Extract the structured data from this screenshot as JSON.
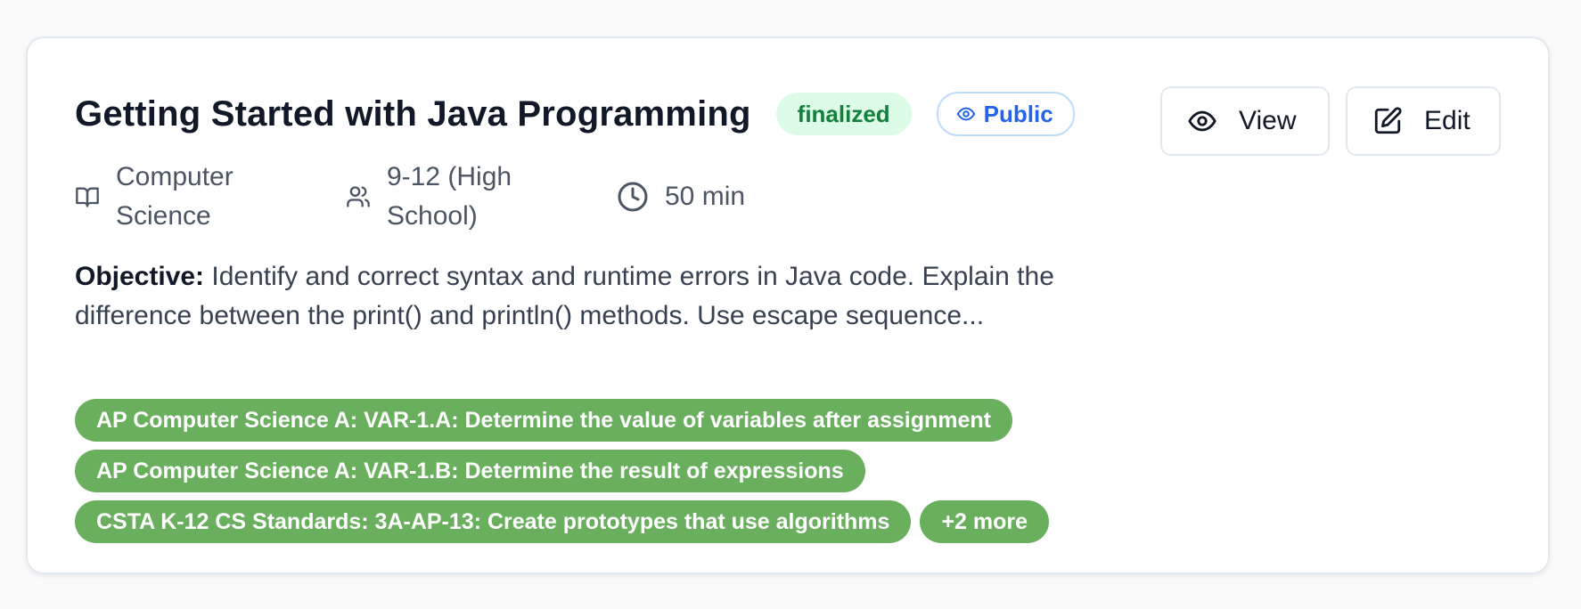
{
  "card": {
    "title": "Getting Started with Java Programming",
    "status_badge": "finalized",
    "visibility_badge": "Public",
    "actions": {
      "view_label": "View",
      "edit_label": "Edit"
    },
    "meta": {
      "subject": "Computer Science",
      "grade": "9-12 (High School)",
      "duration": "50 min"
    },
    "objective": {
      "label": "Objective:",
      "text": "Identify and correct syntax and runtime errors in Java code. Explain the difference between the print() and println() methods. Use escape sequence..."
    },
    "standards": [
      "AP Computer Science A: VAR-1.A: Determine the value of variables after assignment",
      "AP Computer Science A: VAR-1.B: Determine the result of expressions",
      "CSTA K-12 CS Standards: 3A-AP-13: Create prototypes that use algorithms"
    ],
    "more_standards": "+2 more"
  },
  "colors": {
    "status_bg": "#dcfce7",
    "status_text": "#15803d",
    "public_text": "#2563eb",
    "tag_bg": "#6aaf5e"
  },
  "icons": {
    "subject": "book-open-icon",
    "grade": "users-icon",
    "duration": "clock-icon",
    "visibility": "eye-icon",
    "view": "eye-icon",
    "edit": "edit-icon"
  }
}
